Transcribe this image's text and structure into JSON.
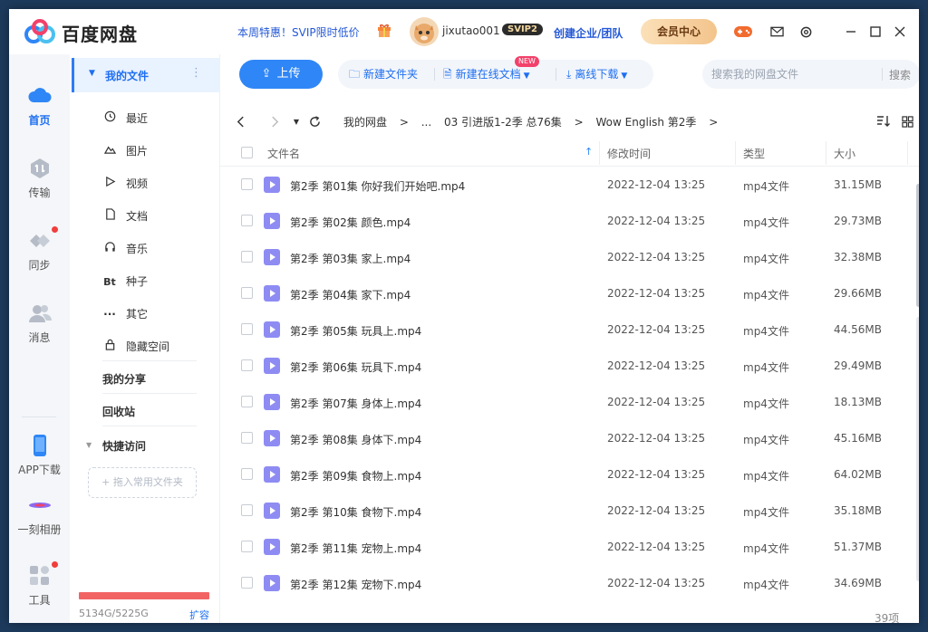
{
  "app": {
    "name": "百度网盘"
  },
  "titlebar": {
    "promo": "本周特惠！SVIP限时低价",
    "username": "jixutao001",
    "svip_badge": "SVIP2",
    "enterprise": "创建企业/团队",
    "vip_center": "会员中心"
  },
  "rail": {
    "items": [
      {
        "label": "首页",
        "icon": "cloud-icon"
      },
      {
        "label": "传输",
        "icon": "transfer-icon"
      },
      {
        "label": "同步",
        "icon": "sync-icon"
      },
      {
        "label": "消息",
        "icon": "message-icon"
      },
      {
        "label": "APP下载",
        "icon": "phone-icon"
      },
      {
        "label": "一刻相册",
        "icon": "album-icon"
      },
      {
        "label": "工具",
        "icon": "tools-icon"
      }
    ]
  },
  "sidebar": {
    "my_files": "我的文件",
    "items": [
      {
        "label": "最近",
        "icon": "clock-icon"
      },
      {
        "label": "图片",
        "icon": "image-icon"
      },
      {
        "label": "视频",
        "icon": "video-icon"
      },
      {
        "label": "文档",
        "icon": "document-icon"
      },
      {
        "label": "音乐",
        "icon": "headphones-icon"
      },
      {
        "label": "种子",
        "icon": "bt-icon"
      },
      {
        "label": "其它",
        "icon": "more-icon"
      },
      {
        "label": "隐藏空间",
        "icon": "lock-icon"
      }
    ],
    "my_share": "我的分享",
    "recycle": "回收站",
    "quick_access": "快捷访问",
    "drop_hint": "+ 拖入常用文件夹",
    "storage": "5134G/5225G",
    "storage_used_fraction": 0.983,
    "expand": "扩容"
  },
  "toolbar": {
    "upload": "上传",
    "new_folder": "新建文件夹",
    "new_online_doc": "新建在线文档",
    "new_badge": "NEW",
    "offline_download": "离线下载",
    "search_placeholder": "搜索我的网盘文件",
    "search_button": "搜索"
  },
  "breadcrumb": [
    "我的网盘",
    ">",
    "...",
    "03 引进版1-2季 总76集",
    ">",
    "Wow English 第2季",
    ">"
  ],
  "table": {
    "headers": {
      "name": "文件名",
      "modified": "修改时间",
      "type": "类型",
      "size": "大小"
    },
    "rows": [
      {
        "name": "第2季 第01集 你好我们开始吧.mp4",
        "modified": "2022-12-04 13:25",
        "type": "mp4文件",
        "size": "31.15MB"
      },
      {
        "name": "第2季 第02集 颜色.mp4",
        "modified": "2022-12-04 13:25",
        "type": "mp4文件",
        "size": "29.73MB"
      },
      {
        "name": "第2季 第03集 家上.mp4",
        "modified": "2022-12-04 13:25",
        "type": "mp4文件",
        "size": "32.38MB"
      },
      {
        "name": "第2季 第04集 家下.mp4",
        "modified": "2022-12-04 13:25",
        "type": "mp4文件",
        "size": "29.66MB"
      },
      {
        "name": "第2季 第05集 玩具上.mp4",
        "modified": "2022-12-04 13:25",
        "type": "mp4文件",
        "size": "44.56MB"
      },
      {
        "name": "第2季 第06集 玩具下.mp4",
        "modified": "2022-12-04 13:25",
        "type": "mp4文件",
        "size": "29.49MB"
      },
      {
        "name": "第2季 第07集 身体上.mp4",
        "modified": "2022-12-04 13:25",
        "type": "mp4文件",
        "size": "18.13MB"
      },
      {
        "name": "第2季 第08集 身体下.mp4",
        "modified": "2022-12-04 13:25",
        "type": "mp4文件",
        "size": "45.16MB"
      },
      {
        "name": "第2季 第09集 食物上.mp4",
        "modified": "2022-12-04 13:25",
        "type": "mp4文件",
        "size": "64.02MB"
      },
      {
        "name": "第2季 第10集 食物下.mp4",
        "modified": "2022-12-04 13:25",
        "type": "mp4文件",
        "size": "35.18MB"
      },
      {
        "name": "第2季 第11集 宠物上.mp4",
        "modified": "2022-12-04 13:25",
        "type": "mp4文件",
        "size": "51.37MB"
      },
      {
        "name": "第2季 第12集 宠物下.mp4",
        "modified": "2022-12-04 13:25",
        "type": "mp4文件",
        "size": "34.69MB"
      }
    ]
  },
  "footer": {
    "item_count": "39项"
  },
  "colors": {
    "accent": "#2f86f6",
    "storage": "#f26464",
    "file_icon": "#8e8cf3"
  }
}
